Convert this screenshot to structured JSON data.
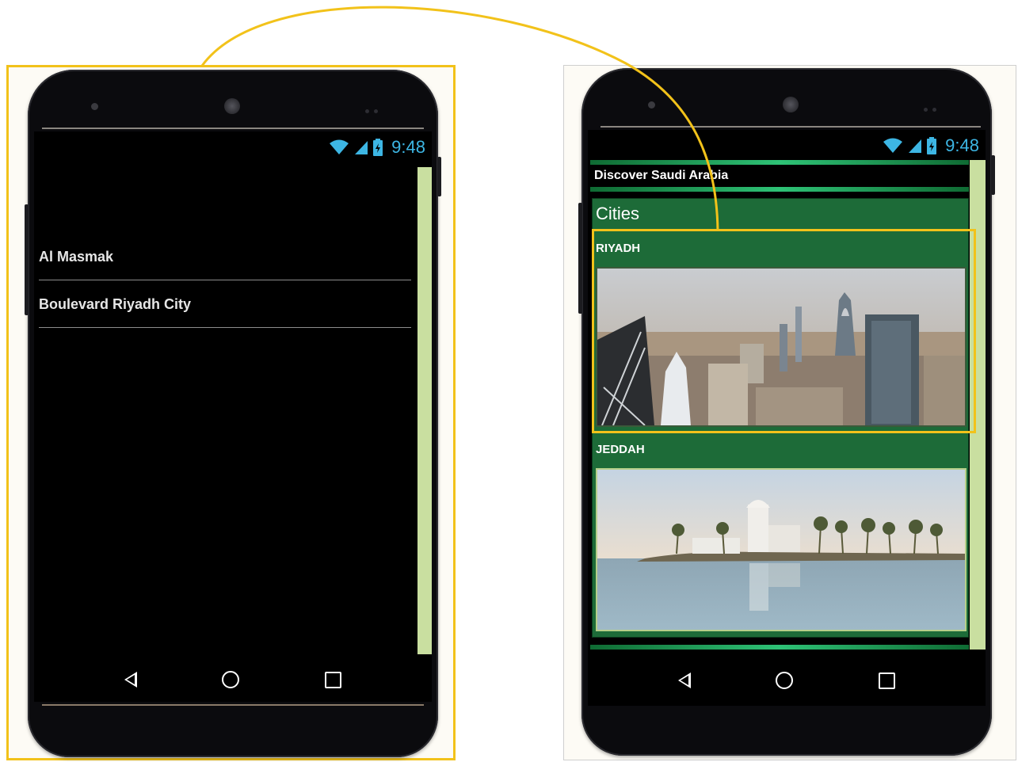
{
  "status_bar": {
    "time": "9:48"
  },
  "left_screen": {
    "list_items": [
      "Al Masmak",
      "Boulevard Riyadh City"
    ]
  },
  "right_screen": {
    "app_title": "Discover Saudi Arabia",
    "section_title": "Cities",
    "cities": [
      {
        "name": "RIYADH",
        "image": "riyadh-skyline-photo"
      },
      {
        "name": "JEDDAH",
        "image": "jeddah-floating-mosque-photo"
      }
    ]
  },
  "colors": {
    "highlight": "#f2c21a",
    "panel_green": "#1d6b38",
    "scroll_green": "#c9dfa0",
    "status_blue": "#3db6e4"
  },
  "icons": {
    "status": [
      "wifi-icon",
      "signal-icon",
      "battery-icon"
    ],
    "navigation": [
      "back-icon",
      "home-icon",
      "recents-icon"
    ]
  }
}
